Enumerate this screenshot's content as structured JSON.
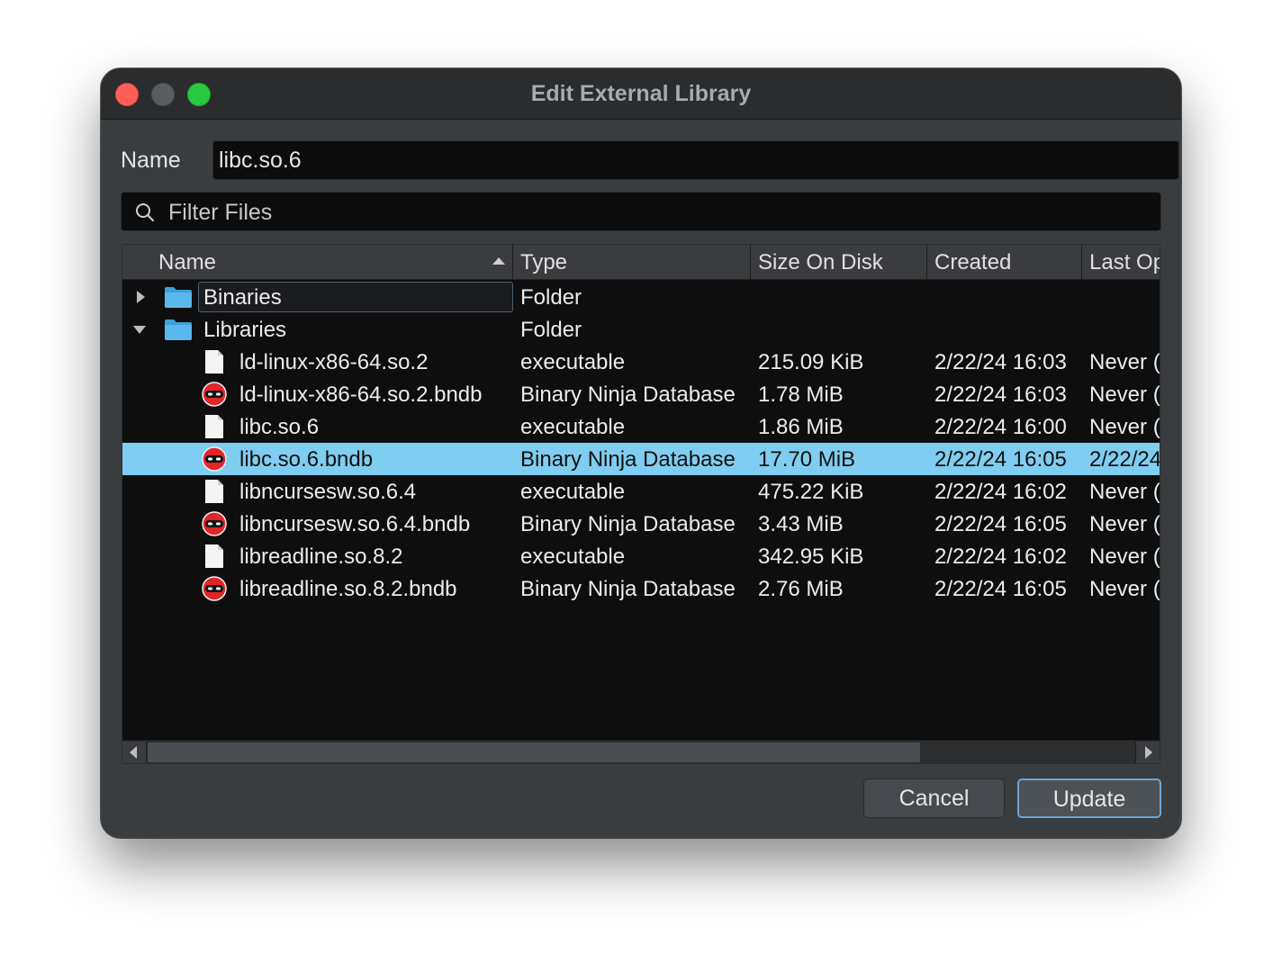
{
  "window": {
    "title": "Edit External Library"
  },
  "name_field": {
    "label": "Name",
    "value": "libc.so.6"
  },
  "filter": {
    "placeholder": "Filter Files"
  },
  "columns": [
    "Name",
    "Type",
    "Size On Disk",
    "Created",
    "Last Op"
  ],
  "rows": [
    {
      "name": "Binaries",
      "type": "Folder",
      "size": "",
      "created": "",
      "last": "",
      "kind": "folder",
      "level": 0,
      "expanded": false
    },
    {
      "name": "Libraries",
      "type": "Folder",
      "size": "",
      "created": "",
      "last": "",
      "kind": "folder",
      "level": 0,
      "expanded": true
    },
    {
      "name": "ld-linux-x86-64.so.2",
      "type": "executable",
      "size": "215.09 KiB",
      "created": "2/22/24 16:03",
      "last": "Never (",
      "kind": "file",
      "level": 1
    },
    {
      "name": "ld-linux-x86-64.so.2.bndb",
      "type": "Binary Ninja Database",
      "size": "1.78 MiB",
      "created": "2/22/24 16:03",
      "last": "Never (",
      "kind": "bndb",
      "level": 1
    },
    {
      "name": "libc.so.6",
      "type": "executable",
      "size": "1.86 MiB",
      "created": "2/22/24 16:00",
      "last": "Never (",
      "kind": "file",
      "level": 1
    },
    {
      "name": "libc.so.6.bndb",
      "type": "Binary Ninja Database",
      "size": "17.70 MiB",
      "created": "2/22/24 16:05",
      "last": "2/22/24",
      "kind": "bndb",
      "level": 1,
      "selected": true
    },
    {
      "name": "libncursesw.so.6.4",
      "type": "executable",
      "size": "475.22 KiB",
      "created": "2/22/24 16:02",
      "last": "Never (",
      "kind": "file",
      "level": 1
    },
    {
      "name": "libncursesw.so.6.4.bndb",
      "type": "Binary Ninja Database",
      "size": "3.43 MiB",
      "created": "2/22/24 16:05",
      "last": "Never (",
      "kind": "bndb",
      "level": 1
    },
    {
      "name": "libreadline.so.8.2",
      "type": "executable",
      "size": "342.95 KiB",
      "created": "2/22/24 16:02",
      "last": "Never (",
      "kind": "file",
      "level": 1
    },
    {
      "name": "libreadline.so.8.2.bndb",
      "type": "Binary Ninja Database",
      "size": "2.76 MiB",
      "created": "2/22/24 16:05",
      "last": "Never (",
      "kind": "bndb",
      "level": 1
    }
  ],
  "buttons": {
    "cancel": "Cancel",
    "update": "Update"
  },
  "colors": {
    "selection": "#7fcdf0",
    "folder": "#5ab8ee",
    "bndb_red": "#e0262b",
    "close": "#ff5f57",
    "maximize": "#28c840"
  }
}
